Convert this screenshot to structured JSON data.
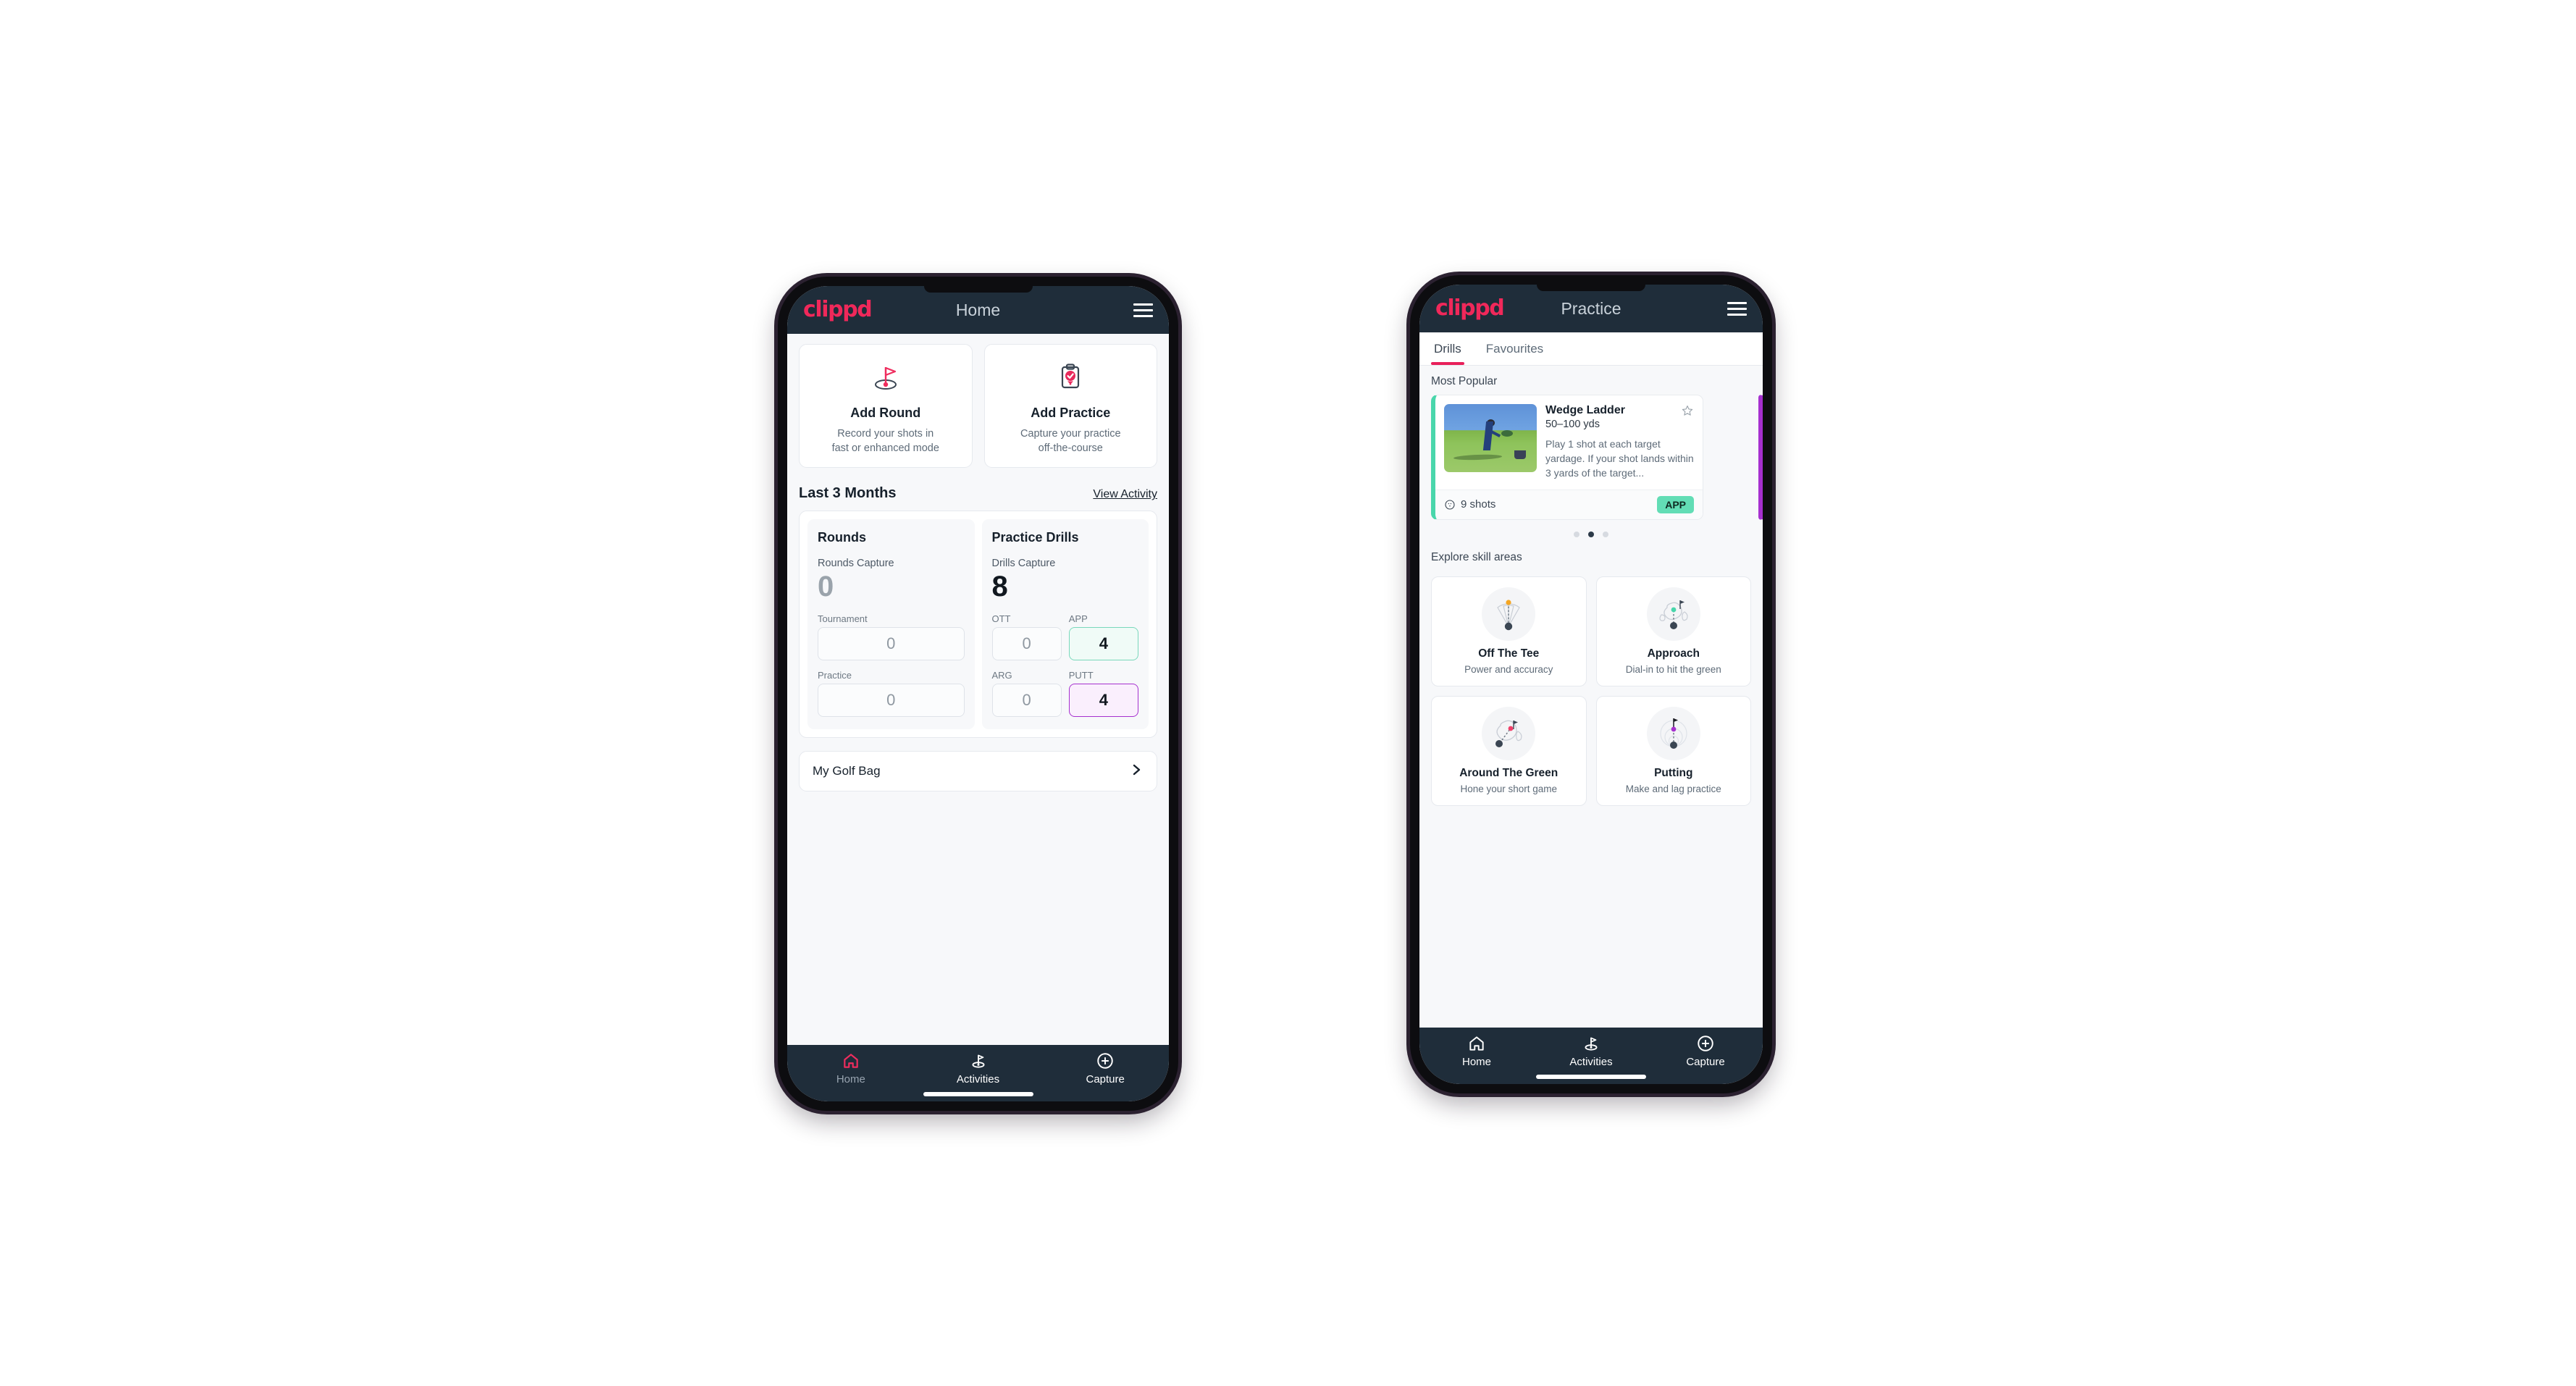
{
  "brand": {
    "logo_text": "clippd",
    "accent": "#f0285a",
    "header_bg": "#1f2d3a"
  },
  "phone_home": {
    "header": {
      "title": "Home",
      "menu_icon": "hamburger-icon"
    },
    "actions": [
      {
        "icon": "golf-flag-icon",
        "title": "Add Round",
        "sub_line1": "Record your shots in",
        "sub_line2": "fast or enhanced mode"
      },
      {
        "icon": "clipboard-check-icon",
        "title": "Add Practice",
        "sub_line1": "Capture your practice",
        "sub_line2": "off-the-course"
      }
    ],
    "section": {
      "title": "Last 3 Months",
      "link": "View Activity"
    },
    "rounds": {
      "heading": "Rounds",
      "capture_label": "Rounds Capture",
      "capture_value": "0",
      "rows": [
        {
          "label": "Tournament",
          "value": "0"
        },
        {
          "label": "Practice",
          "value": "0"
        }
      ]
    },
    "drills": {
      "heading": "Practice Drills",
      "capture_label": "Drills Capture",
      "capture_value": "8",
      "cells": [
        {
          "label": "OTT",
          "value": "0",
          "state": "plain"
        },
        {
          "label": "APP",
          "value": "4",
          "state": "app"
        },
        {
          "label": "ARG",
          "value": "0",
          "state": "plain"
        },
        {
          "label": "PUTT",
          "value": "4",
          "state": "putt"
        }
      ]
    },
    "golf_bag": {
      "label": "My Golf Bag",
      "chevron": "chevron-right-icon"
    },
    "bottom_nav": [
      {
        "label": "Home",
        "icon": "home-icon",
        "active": true
      },
      {
        "label": "Activities",
        "icon": "golf-flag-icon",
        "active": false
      },
      {
        "label": "Capture",
        "icon": "plus-circle-icon",
        "active": false
      }
    ]
  },
  "phone_practice": {
    "header": {
      "title": "Practice",
      "menu_icon": "hamburger-icon"
    },
    "tabs": [
      {
        "label": "Drills",
        "active": true
      },
      {
        "label": "Favourites",
        "active": false
      }
    ],
    "most_popular_label": "Most Popular",
    "drill": {
      "title": "Wedge Ladder",
      "yardage": "50–100 yds",
      "description": "Play 1 shot at each target yardage. If your shot lands within 3 yards of the target...",
      "shots": "9 shots",
      "shots_icon": "golf-ball-icon",
      "badge": "APP",
      "badge_color": "#62ddb5",
      "favourite_icon": "star-outline-icon",
      "accent_color": "#49d6ab",
      "next_card_accent": "#a630cf"
    },
    "carousel_dots": {
      "count": 3,
      "active_index": 1
    },
    "skill_section_label": "Explore skill areas",
    "skills": [
      {
        "title": "Off The Tee",
        "sub": "Power and accuracy",
        "icon": "tee-fan-icon",
        "dot_color": "#f5a623"
      },
      {
        "title": "Approach",
        "sub": "Dial-in to hit the green",
        "icon": "green-approach-icon",
        "dot_color": "#49d6ab"
      },
      {
        "title": "Around The Green",
        "sub": "Hone your short game",
        "icon": "chip-icon",
        "dot_color": "#ef4069"
      },
      {
        "title": "Putting",
        "sub": "Make and lag practice",
        "icon": "putting-rings-icon",
        "dot_color": "#a630cf"
      }
    ],
    "bottom_nav": [
      {
        "label": "Home",
        "icon": "home-icon",
        "active": false
      },
      {
        "label": "Activities",
        "icon": "golf-flag-icon",
        "active": true
      },
      {
        "label": "Capture",
        "icon": "plus-circle-icon",
        "active": false
      }
    ]
  }
}
